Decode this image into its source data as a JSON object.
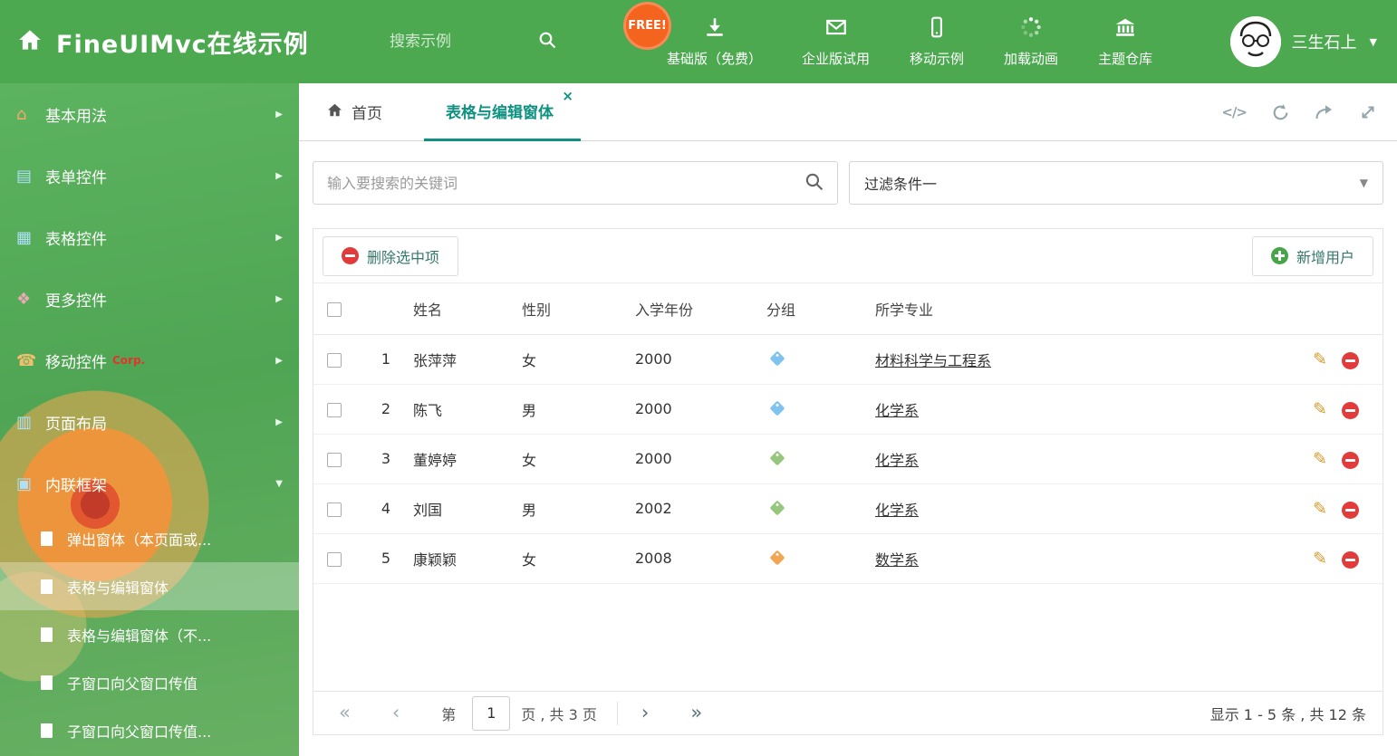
{
  "header": {
    "title": "FineUIMvc在线示例",
    "search_placeholder": "搜索示例",
    "free_badge": "FREE!",
    "nav": [
      {
        "label": "基础版（免费）",
        "icon": "download-icon"
      },
      {
        "label": "企业版试用",
        "icon": "envelope-icon"
      },
      {
        "label": "移动示例",
        "icon": "mobile-icon"
      },
      {
        "label": "加载动画",
        "icon": "spinner-icon"
      },
      {
        "label": "主题仓库",
        "icon": "theme-store-icon"
      }
    ],
    "user_name": "三生石上"
  },
  "sidebar": {
    "items": [
      {
        "label": "基本用法",
        "icon": "home-icon"
      },
      {
        "label": "表单控件",
        "icon": "form-icon"
      },
      {
        "label": "表格控件",
        "icon": "grid-icon"
      },
      {
        "label": "更多控件",
        "icon": "more-icon"
      },
      {
        "label": "移动控件",
        "icon": "mobile-icon",
        "badge": "Corp."
      },
      {
        "label": "页面布局",
        "icon": "layout-icon"
      },
      {
        "label": "内联框架",
        "icon": "frame-icon",
        "expanded": true
      }
    ],
    "subitems": [
      {
        "label": "弹出窗体（本页面或..."
      },
      {
        "label": "表格与编辑窗体",
        "active": true
      },
      {
        "label": "表格与编辑窗体（不..."
      },
      {
        "label": "子窗口向父窗口传值"
      },
      {
        "label": "子窗口向父窗口传值..."
      }
    ]
  },
  "tabs": {
    "home_label": "首页",
    "active_label": "表格与编辑窗体"
  },
  "filters": {
    "search_placeholder": "输入要搜索的关键词",
    "filter_value": "过滤条件一"
  },
  "toolbar": {
    "delete_label": "删除选中项",
    "add_label": "新增用户"
  },
  "table": {
    "columns": {
      "name": "姓名",
      "gender": "性别",
      "year": "入学年份",
      "group": "分组",
      "major": "所学专业"
    },
    "rows": [
      {
        "num": "1",
        "name": "张萍萍",
        "gender": "女",
        "year": "2000",
        "tag_color": "#7fc3ee",
        "major": "材料科学与工程系"
      },
      {
        "num": "2",
        "name": "陈飞",
        "gender": "男",
        "year": "2000",
        "tag_color": "#7fc3ee",
        "major": "化学系"
      },
      {
        "num": "3",
        "name": "董婷婷",
        "gender": "女",
        "year": "2000",
        "tag_color": "#97c77f",
        "major": "化学系"
      },
      {
        "num": "4",
        "name": "刘国",
        "gender": "男",
        "year": "2002",
        "tag_color": "#97c77f",
        "major": "化学系"
      },
      {
        "num": "5",
        "name": "康颖颖",
        "gender": "女",
        "year": "2008",
        "tag_color": "#f2a654",
        "major": "数学系"
      }
    ]
  },
  "pagination": {
    "page_prefix": "第",
    "current_page": "1",
    "page_suffix": "页 , 共 3 页",
    "summary": "显示 1 - 5 条 , 共 12 条"
  },
  "icons": {
    "close": "×",
    "caret_down": "▼",
    "code": "</>",
    "edit_pencil": "✎",
    "page_first": "«",
    "page_prev": "‹",
    "page_next": "›",
    "page_last": "»"
  },
  "colors": {
    "header_green": "#4ca950",
    "accent_teal": "#0f9182",
    "tag_blue": "#7fc3ee",
    "tag_green": "#97c77f",
    "tag_orange": "#f2a654",
    "danger_red": "#e23b3b",
    "success_green": "#46a546",
    "free_badge_orange": "#f5641e"
  }
}
